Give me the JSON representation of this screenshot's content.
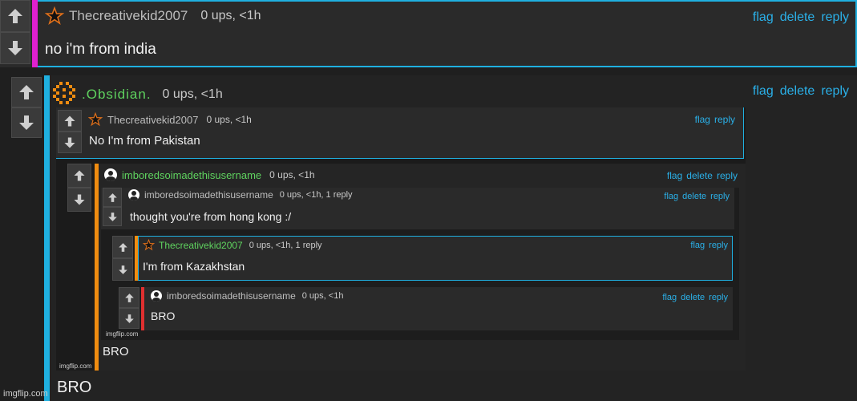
{
  "comment_top": {
    "username": "Thecreativekid2007",
    "meta": "0 ups, <1h",
    "body": "no i'm from india",
    "actions": [
      "flag",
      "delete",
      "reply"
    ]
  },
  "comment_obsidian": {
    "username": ".Obsidian.",
    "meta": "0 ups, <1h",
    "body": "BRO",
    "actions": [
      "flag",
      "delete",
      "reply"
    ]
  },
  "embedded": {
    "c1": {
      "username": "Thecreativekid2007",
      "meta": "0 ups, <1h",
      "body": "No I'm from Pakistan",
      "actions": [
        "flag",
        "reply"
      ]
    },
    "c2": {
      "username": "imboredsoimadethisusername",
      "meta": "0 ups, <1h",
      "body": "BRO",
      "actions": [
        "flag",
        "delete",
        "reply"
      ]
    },
    "c3": {
      "username": "imboredsoimadethisusername",
      "meta": "0 ups, <1h, 1 reply",
      "body": "thought you're from hong kong :/",
      "actions": [
        "flag",
        "delete",
        "reply"
      ]
    },
    "c4": {
      "username": "Thecreativekid2007",
      "meta": "0 ups, <1h, 1 reply",
      "body": "I'm from Kazakhstan",
      "actions": [
        "flag",
        "reply"
      ]
    },
    "c5": {
      "username": "imboredsoimadethisusername",
      "meta": "0 ups, <1h",
      "body": "BRO",
      "actions": [
        "flag",
        "delete",
        "reply"
      ]
    }
  },
  "watermarks": {
    "main": "imgflip.com",
    "inner1": "imgflip.com",
    "inner2": "imgflip.com"
  },
  "colors": {
    "link": "#2ab0e8",
    "magenta": "#e020d0",
    "cyan": "#1fb0e0",
    "orange": "#f08c10",
    "red": "#e03030",
    "green_name": "#5fd35f"
  }
}
